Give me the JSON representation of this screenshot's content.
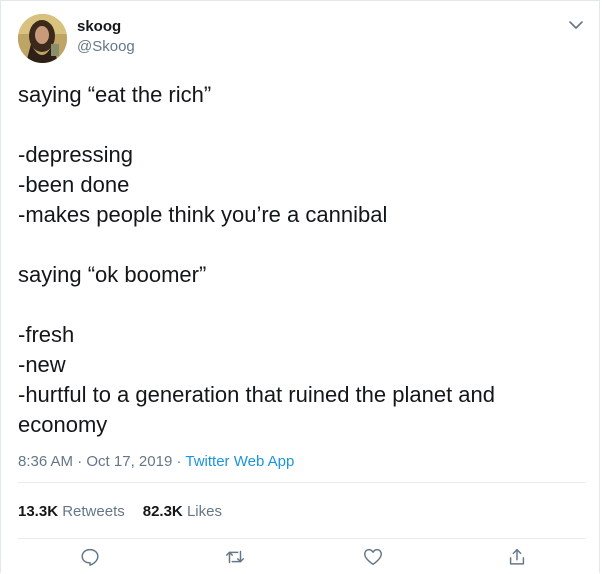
{
  "user": {
    "name": "skoog",
    "handle": "@Skoog"
  },
  "tweet": {
    "lines": [
      "saying “eat the rich”",
      "",
      "-depressing",
      "-been done",
      "-makes people think you’re a cannibal",
      "",
      "saying “ok boomer”",
      "",
      "-fresh",
      "-new",
      "-hurtful to a generation that ruined the planet and",
      "economy"
    ]
  },
  "meta": {
    "time": "8:36 AM",
    "separator": "·",
    "date": "Oct 17, 2019",
    "app": "Twitter Web App"
  },
  "stats": {
    "retweets_count": "13.3K",
    "retweets_label": "Retweets",
    "likes_count": "82.3K",
    "likes_label": "Likes"
  },
  "icons": {
    "reply": "reply-icon",
    "retweet": "retweet-icon",
    "like": "heart-icon",
    "share": "share-icon",
    "caret": "chevron-down-icon"
  },
  "colors": {
    "text": "#14171a",
    "secondary": "#657786",
    "link": "#1b95e0",
    "border": "#e1e8ed"
  }
}
